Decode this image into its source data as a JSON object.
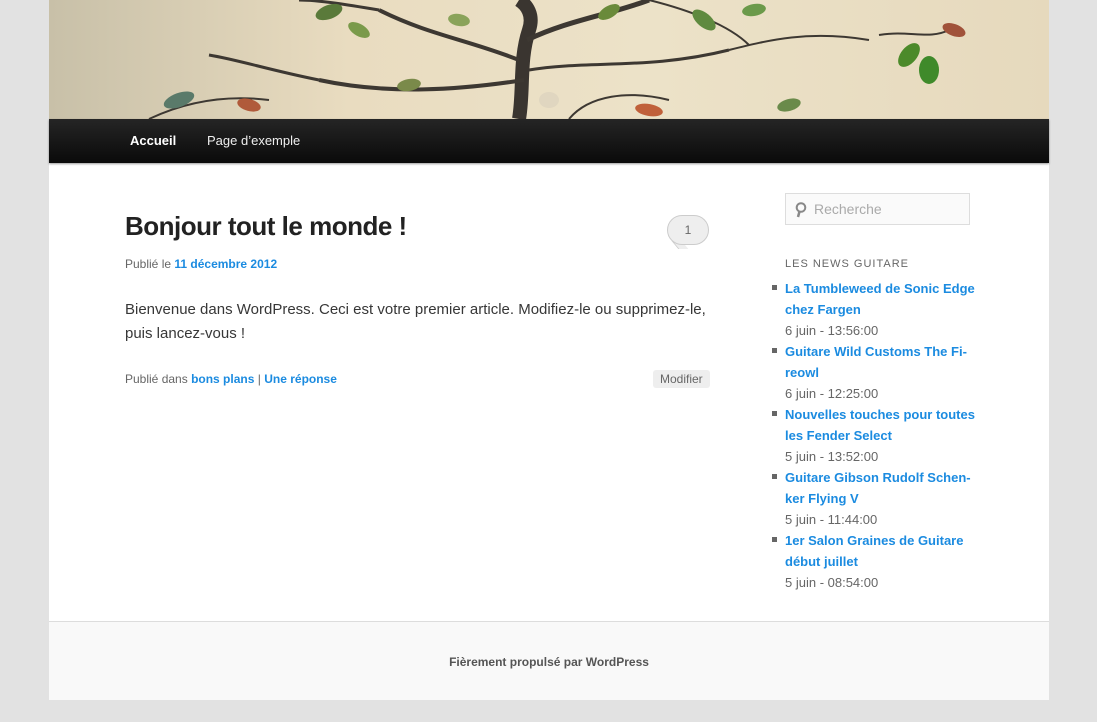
{
  "nav": {
    "items": [
      {
        "label": "Accueil"
      },
      {
        "label": "Page d’exemple"
      }
    ]
  },
  "post": {
    "title": "Bonjour tout le monde !",
    "comment_count": "1",
    "meta_prefix": "Publié le",
    "date": "11 décembre 2012",
    "content": "Bienvenue dans WordPress. Ceci est votre premier article. Modifiez-le ou supprimez-le, puis lancez-vous !",
    "footer_prefix": "Publié dans",
    "category": "bons plans",
    "separator": "|",
    "reply_link": "Une réponse",
    "edit_label": "Modifier"
  },
  "sidebar": {
    "search_placeholder": "Recherche",
    "widget_title": "LES NEWS GUITARE",
    "news": [
      {
        "title": "La Tumbleweed de Sonic Edge chez Fargen",
        "date": "6 juin - 13:56:00"
      },
      {
        "title": "Guitare Wild Customs The Fi-reowl",
        "date": "6 juin - 12:25:00"
      },
      {
        "title": "Nouvelles touches pour toutes les Fender Select",
        "date": "5 juin - 13:52:00"
      },
      {
        "title": "Guitare Gibson Rudolf Schen-ker Flying V",
        "date": "5 juin - 11:44:00"
      },
      {
        "title": "1er Salon Graines de Guitare début juillet",
        "date": "5 juin - 08:54:00"
      }
    ]
  },
  "footer": {
    "credit": "Fièrement propulsé par WordPress"
  },
  "colors": {
    "link": "#1b8be0",
    "nav_bg": "#111111",
    "page_bg": "#e2e2e2"
  }
}
